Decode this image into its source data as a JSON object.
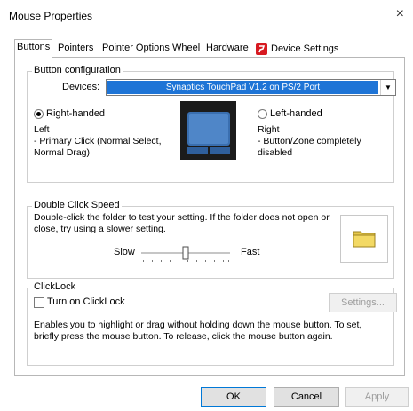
{
  "window": {
    "title": "Mouse Properties",
    "close_glyph": "×"
  },
  "tabs": [
    {
      "label": "Buttons",
      "active": true
    },
    {
      "label": "Pointers"
    },
    {
      "label": "Pointer Options"
    },
    {
      "label": "Wheel"
    },
    {
      "label": "Hardware"
    },
    {
      "label": "Device Settings",
      "icon": "synaptics-icon"
    }
  ],
  "button_config": {
    "legend": "Button configuration",
    "devices_label": "Devices:",
    "device_value": "Synaptics TouchPad V1.2 on PS/2 Port",
    "right_handed_label": "Right-handed",
    "left_handed_label": "Left-handed",
    "left_text": "Left\n- Primary Click (Normal Select, Normal Drag)",
    "right_text": "Right\n- Button/Zone completely disabled"
  },
  "double_click": {
    "legend": "Double Click Speed",
    "description": "Double-click the folder to test your setting.  If the folder does not open or close, try using a slower setting.",
    "slow_label": "Slow",
    "fast_label": "Fast",
    "slider_level": 0.5
  },
  "clicklock": {
    "legend": "ClickLock",
    "checkbox_label": "Turn on ClickLock",
    "settings_button": "Settings...",
    "description": "Enables you to highlight or drag without holding down the mouse button.  To set, briefly press the mouse button.  To release, click the mouse button again."
  },
  "footer": {
    "ok": "OK",
    "cancel": "Cancel",
    "apply": "Apply"
  },
  "colors": {
    "selection": "#1e74d6",
    "synaptics_red": "#d71920"
  }
}
